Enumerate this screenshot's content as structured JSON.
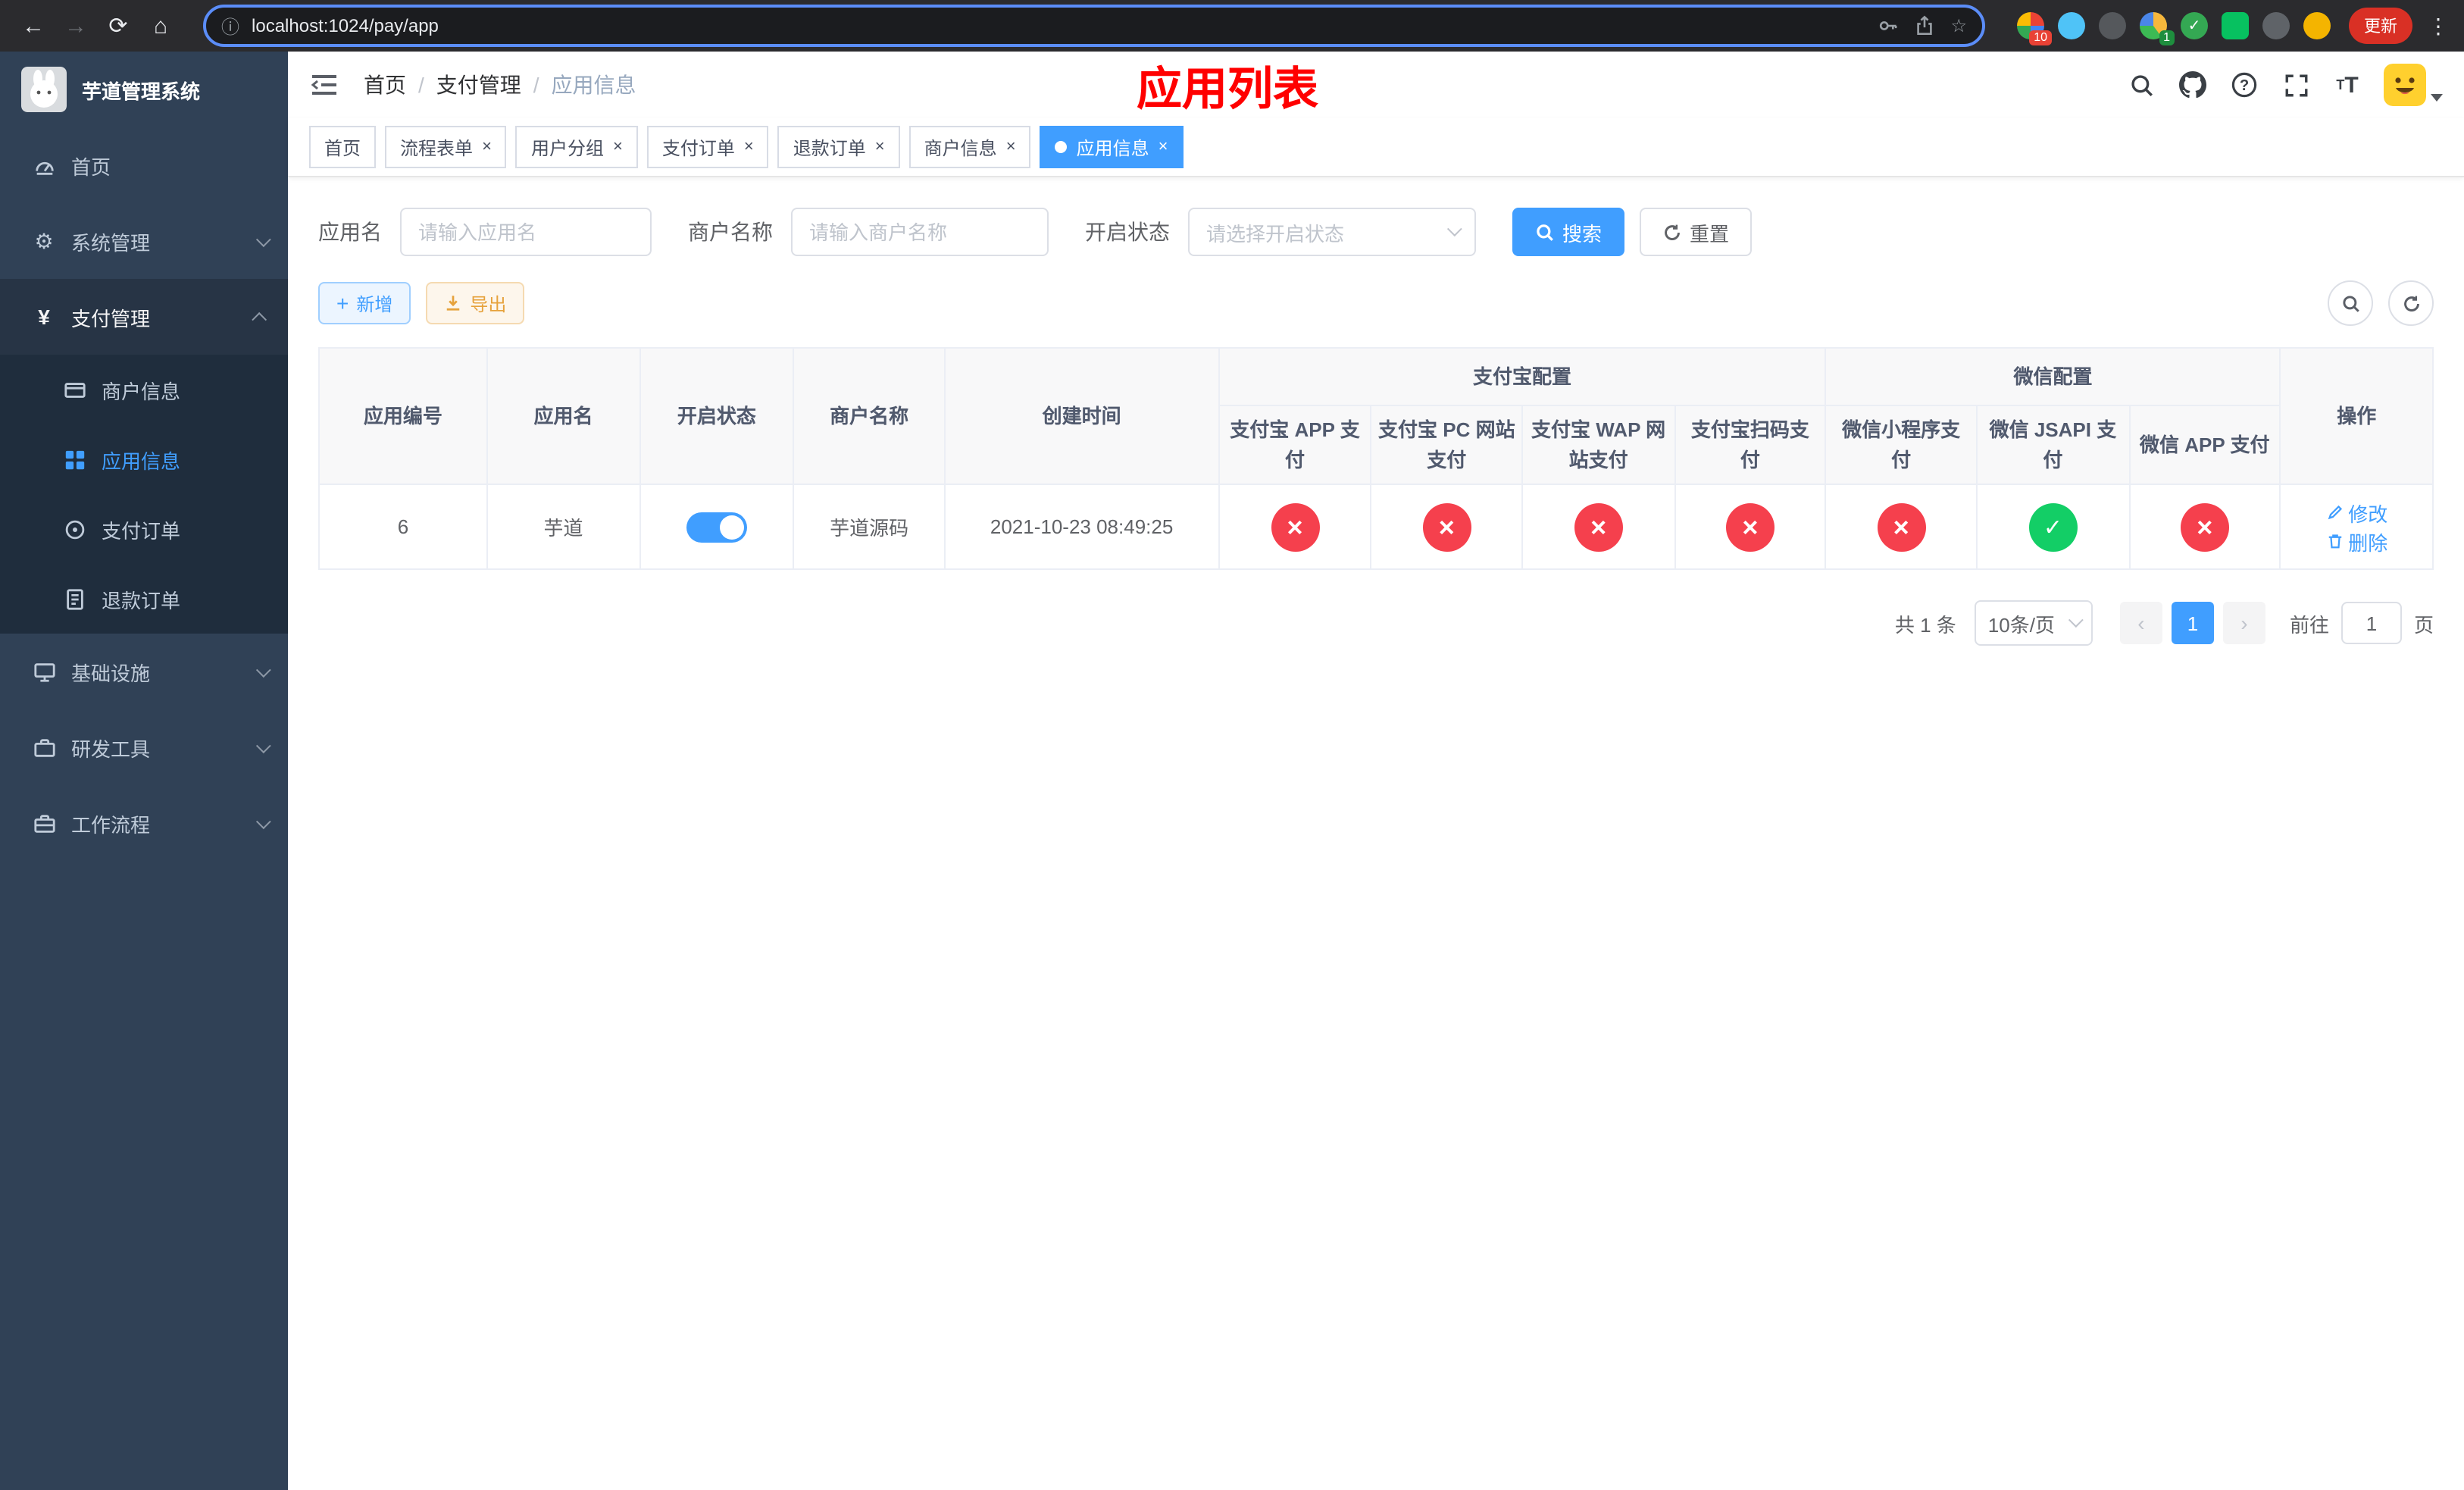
{
  "colors": {
    "accent": "#409eff",
    "danger": "#f5404d",
    "success": "#13ce66",
    "title_red": "#ff0000",
    "sidebar_bg": "#304156",
    "submenu_bg": "#1f2d3d"
  },
  "browser": {
    "url": "localhost:1024/pay/app",
    "update_label": "更新",
    "ext_badge_1": "10",
    "ext_badge_2": "1"
  },
  "sidebar": {
    "title": "芋道管理系统",
    "home": "首页",
    "system": "系统管理",
    "payment": "支付管理",
    "merchant_info": "商户信息",
    "app_info": "应用信息",
    "pay_order": "支付订单",
    "refund_order": "退款订单",
    "infra": "基础设施",
    "devtools": "研发工具",
    "workflow": "工作流程"
  },
  "navbar": {
    "breadcrumb_home": "首页",
    "breadcrumb_section": "支付管理",
    "breadcrumb_current": "应用信息",
    "page_title": "应用列表"
  },
  "tabs": [
    {
      "label": "首页"
    },
    {
      "label": "流程表单"
    },
    {
      "label": "用户分组"
    },
    {
      "label": "支付订单"
    },
    {
      "label": "退款订单"
    },
    {
      "label": "商户信息"
    },
    {
      "label": "应用信息"
    }
  ],
  "filters": {
    "app_name_label": "应用名",
    "app_name_placeholder": "请输入应用名",
    "merchant_label": "商户名称",
    "merchant_placeholder": "请输入商户名称",
    "status_label": "开启状态",
    "status_placeholder": "请选择开启状态",
    "search_label": "搜索",
    "reset_label": "重置"
  },
  "toolbar": {
    "add_label": "新增",
    "export_label": "导出"
  },
  "table": {
    "col_id": "应用编号",
    "col_name": "应用名",
    "col_status": "开启状态",
    "col_merchant": "商户名称",
    "col_created": "创建时间",
    "group_alipay": "支付宝配置",
    "group_wechat": "微信配置",
    "col_alipay_app": "支付宝 APP 支付",
    "col_alipay_pc": "支付宝 PC 网站支付",
    "col_alipay_wap": "支付宝 WAP 网站支付",
    "col_alipay_qr": "支付宝扫码支付",
    "col_wx_mini": "微信小程序支付",
    "col_wx_jsapi": "微信 JSAPI 支付",
    "col_wx_app": "微信 APP 支付",
    "col_actions": "操作",
    "row": {
      "id": "6",
      "name": "芋道",
      "toggle_state": "on",
      "merchant": "芋道源码",
      "created": "2021-10-23 08:49:25",
      "config_states": [
        "no",
        "no",
        "no",
        "no",
        "no",
        "ok",
        "no"
      ],
      "edit_label": "修改",
      "delete_label": "删除"
    }
  },
  "pagination": {
    "total": "共 1 条",
    "page_size": "10条/页",
    "prev": "‹",
    "page_1": "1",
    "next": "›",
    "goto_label": "前往",
    "goto_value": "1",
    "goto_unit": "页"
  }
}
